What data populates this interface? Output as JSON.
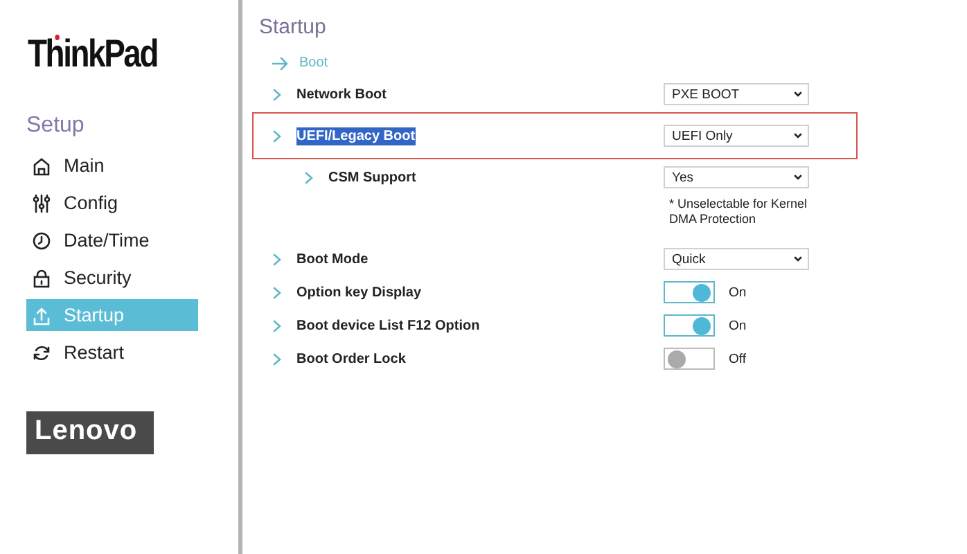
{
  "sidebar": {
    "logo": "ThinkPad",
    "title": "Setup",
    "items": [
      {
        "label": "Main",
        "selected": false
      },
      {
        "label": "Config",
        "selected": false
      },
      {
        "label": "Date/Time",
        "selected": false
      },
      {
        "label": "Security",
        "selected": false
      },
      {
        "label": "Startup",
        "selected": true
      },
      {
        "label": "Restart",
        "selected": false
      }
    ],
    "brand": "Lenovo"
  },
  "page": {
    "title": "Startup",
    "breadcrumb": "Boot"
  },
  "settings": [
    {
      "label": "Network Boot",
      "kind": "select",
      "value": "PXE BOOT",
      "highlighted": false
    },
    {
      "label": "UEFI/Legacy Boot",
      "kind": "select",
      "value": "UEFI Only",
      "highlighted": true,
      "children": [
        {
          "label": "CSM Support",
          "kind": "select",
          "value": "Yes",
          "highlighted": false,
          "note": "* Unselectable for Kernel DMA Protection"
        }
      ]
    },
    {
      "label": "Boot Mode",
      "kind": "select",
      "value": "Quick",
      "highlighted": false
    },
    {
      "label": "Option key Display",
      "kind": "toggle",
      "on": true,
      "value": "On",
      "highlighted": false
    },
    {
      "label": "Boot device List F12 Option",
      "kind": "toggle",
      "on": true,
      "value": "On",
      "highlighted": false
    },
    {
      "label": "Boot Order Lock",
      "kind": "toggle",
      "on": false,
      "value": "Off",
      "highlighted": false
    }
  ]
}
